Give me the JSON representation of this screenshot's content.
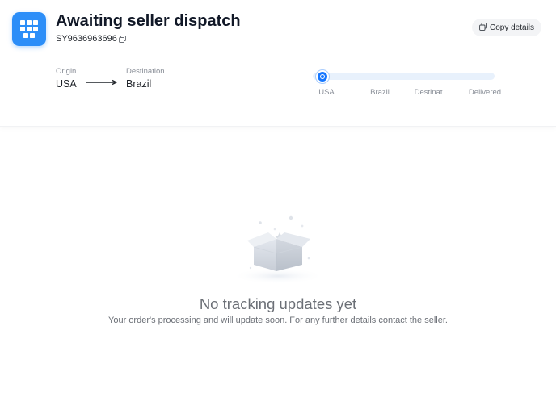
{
  "header": {
    "status_title": "Awaiting seller dispatch",
    "tracking_number": "SY9636963696",
    "copy_details_label": "Copy details"
  },
  "route": {
    "origin_label": "Origin",
    "origin_value": "USA",
    "destination_label": "Destination",
    "destination_value": "Brazil"
  },
  "progress": {
    "steps": [
      "USA",
      "Brazil",
      "Destinat...",
      "Delivered"
    ],
    "current_step": 0
  },
  "empty_state": {
    "title": "No tracking updates yet",
    "subtitle": "Your order's processing and will update soon. For any further details contact the seller."
  },
  "colors": {
    "accent": "#1677ff",
    "app_icon": "#2c8ef8",
    "track": "#e8f1fc"
  },
  "icons": {
    "app": "grid-icon",
    "copy": "copy-icon",
    "arrow": "arrow-right-icon",
    "empty": "empty-box-icon"
  }
}
